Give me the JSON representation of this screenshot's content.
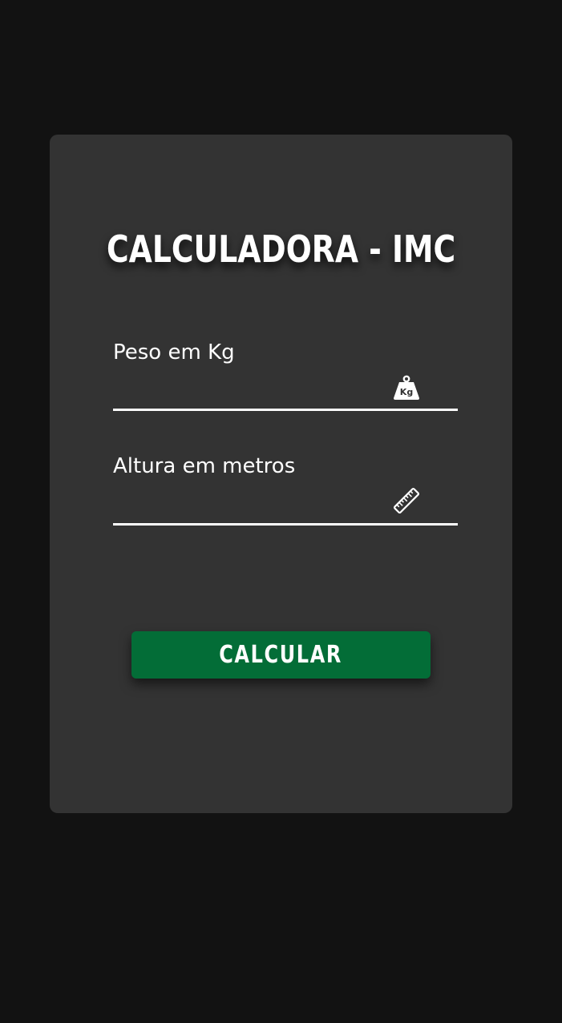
{
  "app": {
    "title": "CALCULADORA - IMC"
  },
  "form": {
    "weight": {
      "label": "Peso em Kg",
      "value": "",
      "icon": "kg-weight-icon"
    },
    "height": {
      "label": "Altura em metros",
      "value": "",
      "icon": "ruler-icon"
    },
    "submit_label": "CALCULAR"
  },
  "colors": {
    "background": "#121212",
    "card": "#333333",
    "text": "#ffffff",
    "button": "#036d37"
  }
}
